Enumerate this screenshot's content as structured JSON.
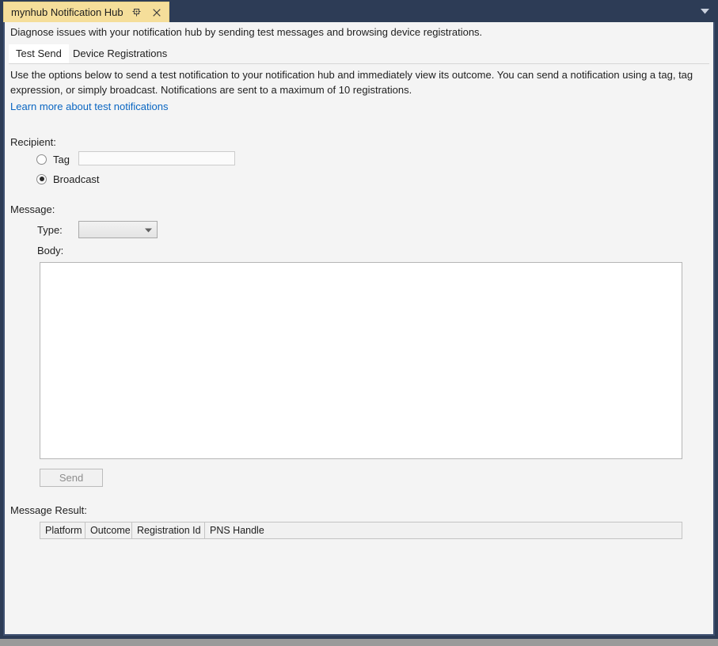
{
  "window": {
    "document_tab": {
      "title": "mynhub Notification Hub",
      "pin_icon": "pin-icon",
      "close_icon": "close-icon"
    },
    "titlebar_dropdown_icon": "chevron-down-icon"
  },
  "intro": "Diagnose issues with your notification hub by sending test messages and browsing device registrations.",
  "tabs": [
    {
      "label": "Test Send",
      "selected": true
    },
    {
      "label": "Device Registrations",
      "selected": false
    }
  ],
  "test_send": {
    "description": "Use the options below to send a test notification to your notification hub and immediately view its outcome. You can send a notification using a tag, tag expression, or simply broadcast. Notifications are sent to a maximum of 10 registrations.",
    "learn_more_link": "Learn more about test notifications",
    "recipient": {
      "label": "Recipient:",
      "options": [
        {
          "label": "Tag",
          "selected": false
        },
        {
          "label": "Broadcast",
          "selected": true
        }
      ],
      "tag_input": {
        "value": "",
        "placeholder": ""
      }
    },
    "message": {
      "label": "Message:",
      "type": {
        "label": "Type:",
        "selected_value": "",
        "arrow_icon": "chevron-down-icon"
      },
      "body": {
        "label": "Body:",
        "value": "",
        "placeholder": ""
      }
    },
    "send_button": {
      "label": "Send",
      "enabled": false
    },
    "result": {
      "label": "Message Result:",
      "columns": [
        "Platform",
        "Outcome",
        "Registration Id",
        "PNS Handle"
      ],
      "rows": []
    }
  },
  "colors": {
    "titlebar": "#2d3c56",
    "active_tab": "#f5de9a",
    "client_bg": "#f4f4f4",
    "link": "#0a66c2",
    "border": "#3f5070"
  }
}
